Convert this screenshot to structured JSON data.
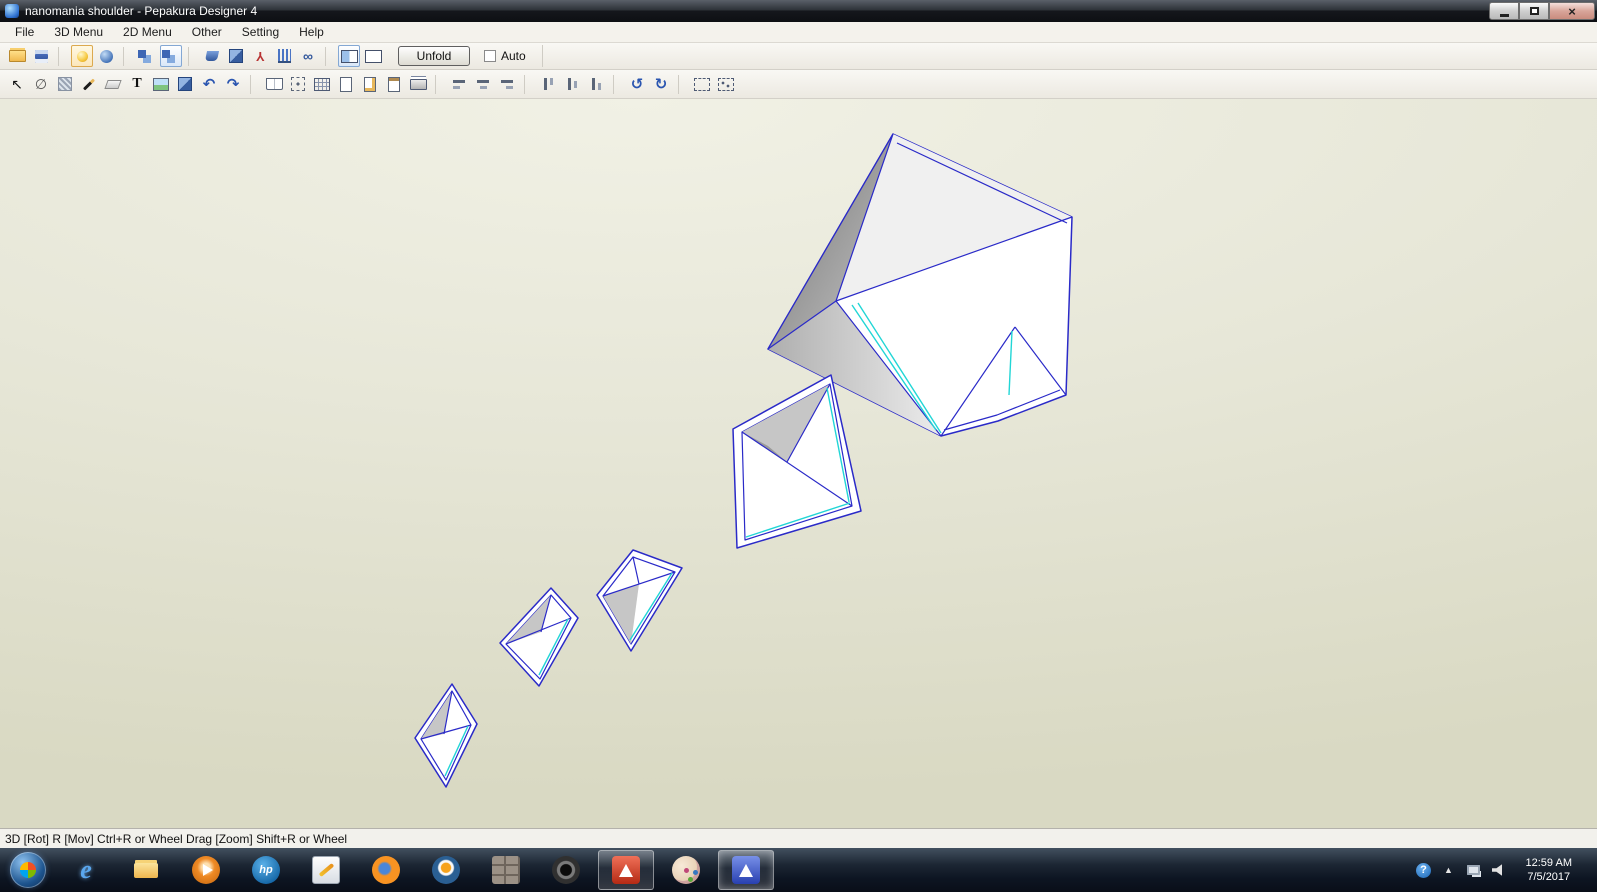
{
  "window": {
    "title": "nanomania shoulder - Pepakura Designer 4"
  },
  "menu": {
    "items": [
      "File",
      "3D Menu",
      "2D Menu",
      "Other",
      "Setting",
      "Help"
    ]
  },
  "toolbar1": {
    "icons": [
      "open-icon",
      "save-icon",
      "separator",
      "light-toggle-icon",
      "orbit-view-icon",
      "separator",
      "rotate-mode-icon",
      "move-mode-icon",
      "separator",
      "paint-bucket-icon",
      "cube-icon",
      "axis-icon",
      "meter-icon",
      "link-icon",
      "separator",
      "split-view-icon",
      "single-view-icon"
    ],
    "unfold_label": "Unfold",
    "auto_label": "Auto"
  },
  "toolbar2": {
    "icons": [
      "select-icon",
      "divide-icon",
      "mesh-icon",
      "pen-icon",
      "eraser-icon",
      "text-icon",
      "image-icon",
      "box-icon",
      "undo-icon",
      "redo-icon",
      "separator",
      "book-icon",
      "transform-icon",
      "table-icon",
      "page-icon",
      "page-setup-icon",
      "clipboard-icon",
      "print-icon",
      "separator",
      "align-left-icon",
      "align-center-icon",
      "align-right-icon",
      "separator",
      "align-top-icon",
      "align-middle-icon",
      "align-bottom-icon",
      "separator",
      "rotate-left-icon",
      "rotate-right-icon",
      "separator",
      "marquee-icon",
      "pack-parts-icon"
    ]
  },
  "statusbar": {
    "text": "3D [Rot] R [Mov] Ctrl+R or Wheel Drag [Zoom] Shift+R or Wheel"
  },
  "taskbar": {
    "items": [
      "ie-icon",
      "explorer-icon",
      "media-player-icon",
      "hp-icon",
      "capture-icon",
      "firefox-icon",
      "blender-icon",
      "bricks-icon",
      "lens-icon",
      "pepakura-viewer-icon",
      "paint-icon",
      "pepakura-designer-icon"
    ],
    "tray_icons": [
      "help-icon",
      "tray-up-arrow-icon",
      "network-icon",
      "volume-icon"
    ],
    "clock": {
      "time": "12:59 AM",
      "date": "7/5/2017"
    }
  },
  "colors": {
    "edge_blue": "#2a2ac8",
    "accent_cyan": "#22d6d6",
    "viewport_bg": "#e7e7d8"
  }
}
